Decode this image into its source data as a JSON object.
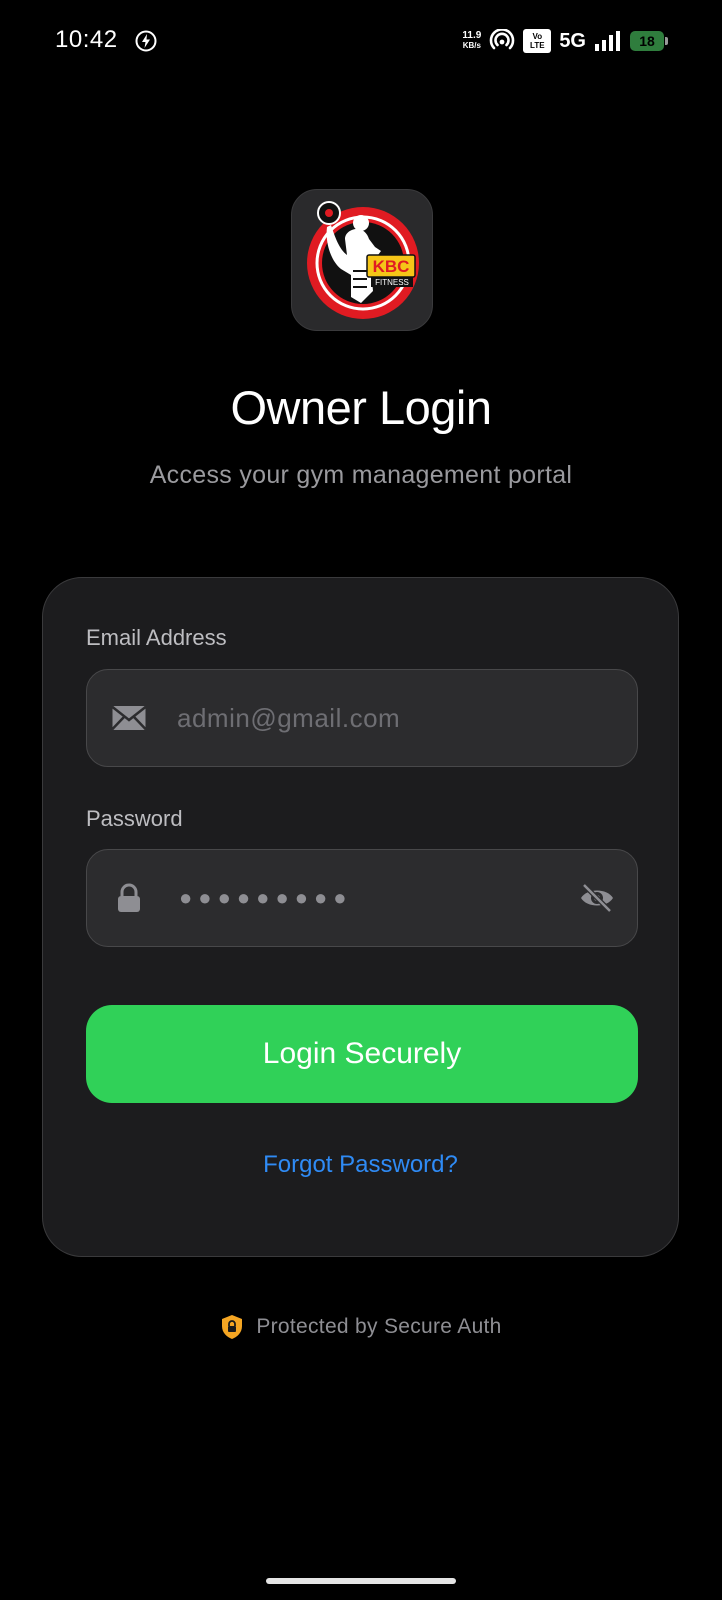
{
  "status_bar": {
    "time": "10:42",
    "net_speed_value": "11.9",
    "net_speed_unit": "KB/s",
    "volte_top": "Vo",
    "volte_bottom": "LTE",
    "network": "5G",
    "battery": "18",
    "icons": [
      "bolt-icon",
      "hotspot-icon",
      "signal-bars-icon",
      "battery-icon"
    ]
  },
  "app": {
    "logo_text": "KBC",
    "logo_subtext": "FITNESS",
    "title": "Owner Login",
    "subtitle": "Access your gym management portal"
  },
  "form": {
    "email": {
      "label": "Email Address",
      "placeholder": "admin@gmail.com",
      "icon": "mail-icon"
    },
    "password": {
      "label": "Password",
      "masked_value": "●●●●●●●●●",
      "icon": "lock-icon",
      "toggle_icon": "eye-off-icon"
    },
    "submit_label": "Login Securely",
    "forgot_label": "Forgot Password?"
  },
  "footer": {
    "secure_text": "Protected by Secure Auth",
    "icon": "shield-lock-icon"
  },
  "colors": {
    "background": "#000000",
    "card": "#1c1c1e",
    "input": "#2c2c2e",
    "accent_green": "#30d158",
    "link_blue": "#2f8bf5",
    "shield_orange": "#f5a623",
    "logo_red": "#e01b22"
  }
}
